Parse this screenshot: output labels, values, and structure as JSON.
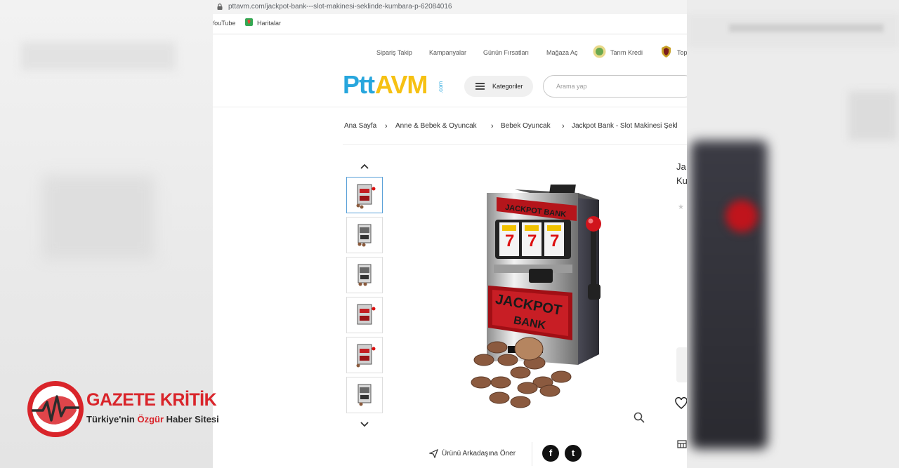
{
  "browser": {
    "url": "pttavm.com/jackpot-bank---slot-makinesi-seklinde-kumbara-p-62084016",
    "bookmarks": [
      "YouTube",
      "Haritalar"
    ]
  },
  "header": {
    "top_links": [
      "Sipariş Takip",
      "Kampanyalar",
      "Günün Fırsatları",
      "Mağaza Aç",
      "Tarım Kredi",
      "Top"
    ],
    "logo": {
      "ptt": "Ptt",
      "avm": "AVM",
      "com": ".com"
    },
    "categories_label": "Kategoriler",
    "search_placeholder": "Arama yap"
  },
  "breadcrumb": [
    "Ana Sayfa",
    "Anne & Bebek & Oyuncak",
    "Bebek Oyuncak",
    "Jackpot Bank - Slot Makinesi Şekl"
  ],
  "product": {
    "title_line1": "Ja",
    "title_line2": "Ku",
    "rating_star": "★",
    "image_text_top": "JACKPOT BANK",
    "image_text_main": "JACKPOT",
    "image_text_bank": "BANK",
    "thumbnails_count": 6,
    "recommend_label": "Ürünü Arkadaşına Öner",
    "social": [
      "f",
      "t"
    ]
  },
  "watermark": {
    "title": "GAZETE KRİTİK",
    "subtitle_pre": "Türkiye'nin ",
    "subtitle_hl": "Özgür",
    "subtitle_post": " Haber Sitesi"
  },
  "colors": {
    "ptt_blue": "#27a6dd",
    "avm_yellow": "#f6c113",
    "watermark_red": "#d9242a"
  }
}
